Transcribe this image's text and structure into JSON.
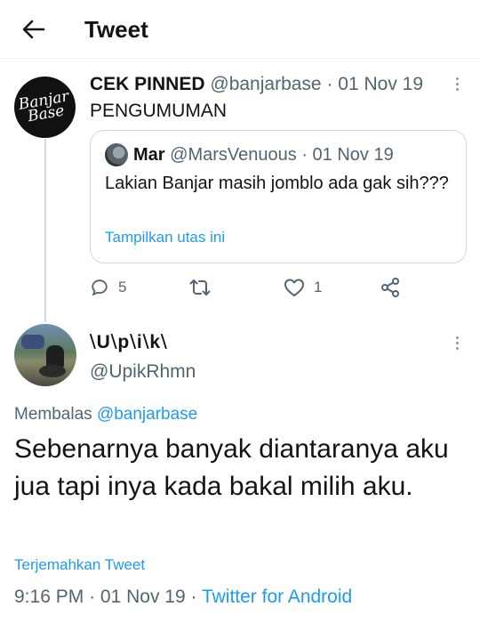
{
  "header": {
    "title": "Tweet",
    "back_icon": "arrow-left-icon"
  },
  "pinned_tweet": {
    "avatar_text": "Banjar Base",
    "name": "CEK PINNED",
    "handle": "@banjarbase",
    "sep": "·",
    "date": "01 Nov 19",
    "text": "PENGUMUMAN",
    "quote": {
      "name": "Mar",
      "handle": "@MarsVenuous",
      "sep": "·",
      "date": "01 Nov 19",
      "text": "Lakian Banjar masih jomblo ada gak sih???",
      "show_thread": "Tampilkan utas ini"
    },
    "actions": {
      "replies": "5",
      "retweets": "",
      "likes": "1"
    }
  },
  "reply_tweet": {
    "name": "⧵U⧵p⧵i⧵k⧵",
    "handle": "@UpikRhmn",
    "replying_prefix": "Membalas",
    "replying_to": "@banjarbase",
    "text": "Sebenarnya banyak diantaranya aku jua tapi inya kada bakal milih aku.",
    "translate": "Terjemahkan Tweet",
    "time": "9:16 PM",
    "sep": "·",
    "date": "01 Nov 19",
    "source": "Twitter for Android"
  },
  "colors": {
    "accent": "#1d9bf0",
    "secondary_text": "#536471",
    "border": "#cfd9de"
  }
}
